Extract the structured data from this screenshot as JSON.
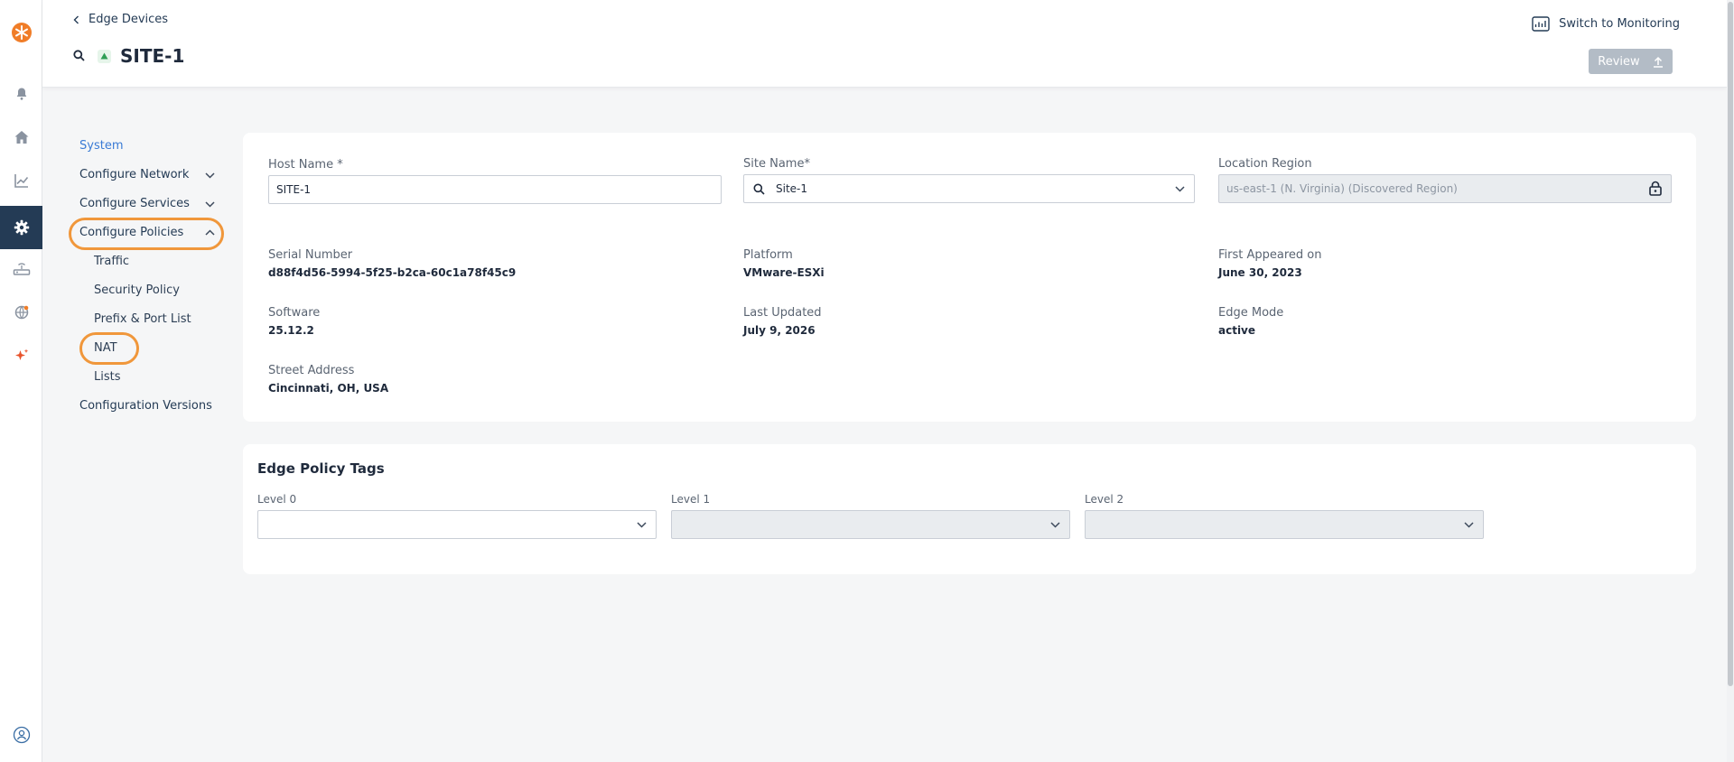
{
  "header": {
    "back_label": "Edge Devices",
    "site_title": "SITE-1",
    "switch_label": "Switch to Monitoring",
    "review_label": "Review"
  },
  "nav": {
    "system": "System",
    "configure_network": "Configure Network",
    "configure_services": "Configure Services",
    "configure_policies": "Configure Policies",
    "traffic": "Traffic",
    "security_policy": "Security Policy",
    "prefix_port_list": "Prefix & Port List",
    "nat": "NAT",
    "lists": "Lists",
    "configuration_versions": "Configuration Versions"
  },
  "details": {
    "host_name_label": "Host Name *",
    "host_name_value": "SITE-1",
    "site_name_label": "Site Name*",
    "site_name_value": "Site-1",
    "location_region_label": "Location Region",
    "location_region_placeholder": "us-east-1 (N. Virginia) (Discovered Region)",
    "serial_number_label": "Serial Number",
    "serial_number_value": "d88f4d56-5994-5f25-b2ca-60c1a78f45c9",
    "platform_label": "Platform",
    "platform_value": "VMware-ESXi",
    "first_appeared_label": "First Appeared on",
    "first_appeared_value": "June 30, 2023",
    "software_label": "Software",
    "software_value": "25.12.2",
    "last_updated_label": "Last Updated",
    "last_updated_value": "July 9, 2026",
    "edge_mode_label": "Edge Mode",
    "edge_mode_value": "active",
    "street_address_label": "Street Address",
    "street_address_value": "Cincinnati, OH, USA"
  },
  "tags": {
    "title": "Edge Policy Tags",
    "level0_label": "Level 0",
    "level1_label": "Level 1",
    "level2_label": "Level 2"
  },
  "colors": {
    "rail_active": "#243b55",
    "link": "#3a7bd5",
    "highlight": "#f0973b",
    "brand": "#f07d28"
  }
}
